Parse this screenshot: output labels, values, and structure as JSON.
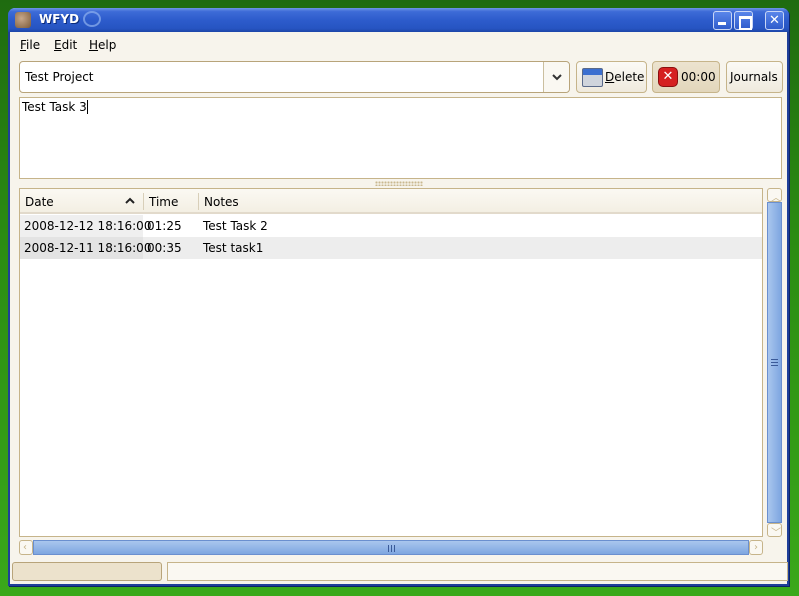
{
  "window": {
    "title": "WFYD",
    "icons": {
      "app": "app-icon",
      "logo": "opensuse-logo-icon"
    },
    "controls": {
      "minimize": "minimize-icon",
      "maximize": "maximize-icon",
      "close": "close-icon"
    }
  },
  "menubar": {
    "items": [
      {
        "label_mnemonic": "F",
        "label_rest": "ile"
      },
      {
        "label_mnemonic": "E",
        "label_rest": "dit"
      },
      {
        "label_mnemonic": "H",
        "label_rest": "elp"
      }
    ]
  },
  "toolbar": {
    "project_value": "Test Project",
    "delete_button": {
      "mnemonic": "D",
      "rest": "elete",
      "icon": "shredder-icon"
    },
    "timer_button": {
      "label": "00:00",
      "icon": "stop-icon",
      "pressed": true
    },
    "journals_button": {
      "label": "Journals"
    }
  },
  "task_entry": {
    "value": "Test Task 3"
  },
  "table": {
    "columns": [
      {
        "label": "Date",
        "sort": "ascending"
      },
      {
        "label": "Time"
      },
      {
        "label": "Notes"
      }
    ],
    "rows": [
      {
        "date": "2008-12-12 18:16:00",
        "time": "01:25",
        "notes": "Test Task 2"
      },
      {
        "date": "2008-12-11 18:16:00",
        "time": "00:35",
        "notes": "Test task1"
      }
    ]
  },
  "statusbar": {
    "left": "",
    "right": ""
  }
}
